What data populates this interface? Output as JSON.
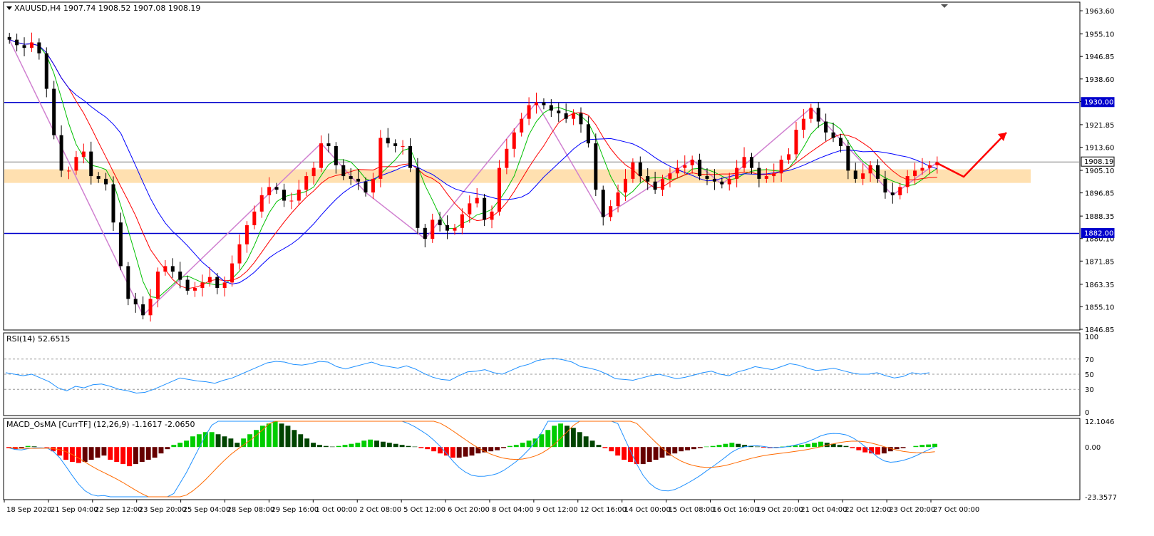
{
  "chart_data": {
    "type": "candlestick",
    "symbol_header": "XAUUSD,H4  1907.74 1908.52 1907.08 1908.19",
    "price_axis": {
      "ticks": [
        "1963.60",
        "1955.10",
        "1946.85",
        "1938.60",
        "1930.00",
        "1921.85",
        "1913.60",
        "1908.19",
        "1905.10",
        "1896.85",
        "1888.35",
        "1880.10",
        "1882.00",
        "1871.85",
        "1863.35",
        "1855.10",
        "1846.85"
      ],
      "tick_values": [
        1963.6,
        1955.1,
        1946.85,
        1938.6,
        1930.35,
        1921.85,
        1913.6,
        1905.1,
        1896.85,
        1888.35,
        1880.1,
        1871.85,
        1863.35,
        1855.1,
        1846.85
      ],
      "ylim": [
        1846.85,
        1966.5
      ],
      "levels": [
        {
          "label": "1930.00",
          "value": 1930.0,
          "color": "#0000cc"
        },
        {
          "label": "1882.00",
          "value": 1882.0,
          "color": "#0000cc"
        },
        {
          "label": "1908.19",
          "value": 1908.19,
          "color": "#808080"
        }
      ],
      "zone": {
        "low": 1900.5,
        "high": 1905.5,
        "color": "#ffe0b0"
      }
    },
    "time_axis": [
      "18 Sep 2020",
      "21 Sep 04:00",
      "22 Sep 12:00",
      "23 Sep 20:00",
      "25 Sep 04:00",
      "28 Sep 08:00",
      "29 Sep 16:00",
      "1 Oct 00:00",
      "2 Oct 08:00",
      "5 Oct 12:00",
      "6 Oct 20:00",
      "8 Oct 04:00",
      "9 Oct 12:00",
      "12 Oct 16:00",
      "14 Oct 00:00",
      "15 Oct 08:00",
      "16 Oct 16:00",
      "19 Oct 20:00",
      "21 Oct 04:00",
      "22 Oct 12:00",
      "23 Oct 20:00",
      "27 Oct 00:00"
    ],
    "close_path": [
      1953,
      1951,
      1950,
      1952,
      1948,
      1935,
      1918,
      1905,
      1905,
      1910,
      1912,
      1903,
      1902,
      1900,
      1886,
      1870,
      1858,
      1856,
      1852,
      1858,
      1868,
      1870,
      1868,
      1865,
      1861,
      1862,
      1864,
      1866,
      1862,
      1864,
      1871,
      1878,
      1885,
      1890,
      1896,
      1899,
      1898,
      1894,
      1894,
      1898,
      1903,
      1906,
      1915,
      1914,
      1907,
      1903,
      1902,
      1901,
      1897,
      1902,
      1917,
      1915,
      1914,
      1914,
      1906,
      1884,
      1880,
      1887,
      1885,
      1883,
      1884,
      1889,
      1893,
      1895,
      1887,
      1890,
      1906,
      1913,
      1919,
      1924,
      1929,
      1930,
      1929,
      1927,
      1926,
      1924,
      1926,
      1922,
      1915,
      1898,
      1888,
      1892,
      1897,
      1902,
      1908,
      1903,
      1901,
      1898,
      1902,
      1904,
      1906,
      1907,
      1909,
      1903,
      1902,
      1901,
      1900,
      1902,
      1906,
      1910,
      1906,
      1902,
      1903,
      1904,
      1909,
      1911,
      1920,
      1924,
      1928,
      1923,
      1919,
      1917,
      1914,
      1905,
      1902,
      1904,
      1907,
      1902,
      1897,
      1896,
      1899,
      1903,
      1905,
      1906,
      1907,
      1908
    ],
    "price_levels": {
      "zigzag_color": "#d080d0",
      "ma_fast": "#00c000",
      "ma_mid": "#ff0000",
      "ma_slow": "#0000ff"
    },
    "rsi": {
      "label": "RSI(14) 52.6515",
      "ticks": [
        "100",
        "70",
        "50",
        "30",
        "0"
      ],
      "tick_values": [
        100,
        70,
        50,
        30,
        0
      ],
      "levels": [
        70,
        50,
        30
      ],
      "values": [
        52,
        50,
        48,
        50,
        45,
        40,
        32,
        28,
        34,
        32,
        36,
        37,
        34,
        30,
        28,
        25,
        26,
        30,
        35,
        40,
        45,
        43,
        41,
        40,
        38,
        42,
        45,
        50,
        55,
        60,
        65,
        67,
        66,
        63,
        62,
        64,
        67,
        66,
        60,
        57,
        60,
        63,
        66,
        62,
        60,
        58,
        61,
        57,
        51,
        46,
        43,
        42,
        48,
        53,
        54,
        56,
        52,
        50,
        55,
        60,
        63,
        68,
        70,
        71,
        69,
        66,
        60,
        58,
        55,
        50,
        44,
        43,
        42,
        45,
        48,
        50,
        47,
        44,
        46,
        49,
        52,
        54,
        50,
        48,
        53,
        56,
        60,
        58,
        56,
        60,
        64,
        62,
        58,
        55,
        56,
        58,
        55,
        52,
        50,
        50,
        52,
        48,
        45,
        47,
        52,
        50,
        52
      ]
    },
    "macd": {
      "label": "MACD_OsMA [CurrTF] (12,26,9) -1.1617 -2.0650",
      "ticks": [
        "12.1046",
        "0.00",
        "-23.3577"
      ],
      "tick_values": [
        12.1046,
        0,
        -23.3577
      ],
      "histogram": [
        -0.5,
        -1,
        -0.5,
        0.5,
        0.3,
        0,
        -0.2,
        -2,
        -4,
        -6,
        -7,
        -7.5,
        -7,
        -6,
        -5,
        -4,
        -6,
        -7,
        -8,
        -9,
        -8,
        -7,
        -6,
        -5,
        -3,
        -1,
        1,
        2,
        3,
        5,
        6,
        7,
        7,
        6,
        5,
        4,
        2,
        4,
        6,
        8,
        10,
        11,
        12,
        11,
        10,
        8,
        6,
        4,
        2,
        1,
        0.5,
        0.2,
        0.5,
        1,
        1.5,
        2,
        3,
        3.5,
        3,
        2.5,
        2,
        1.5,
        1,
        0.5,
        0.2,
        -0.5,
        -1,
        -2,
        -3,
        -4,
        -5,
        -5,
        -4.5,
        -4,
        -3,
        -2.5,
        -2,
        -1.5,
        -0.5,
        0.5,
        1,
        2,
        3,
        4,
        6,
        8,
        10,
        11,
        10,
        9,
        7,
        5,
        3,
        1,
        -0.5,
        -2,
        -4,
        -6,
        -7,
        -8,
        -8,
        -7,
        -6,
        -5,
        -4,
        -3,
        -2,
        -1.5,
        -1,
        -0.5,
        0.2,
        0.5,
        1,
        1.5,
        2,
        1.5,
        1,
        0.5,
        0.2,
        -0.3,
        -0.5,
        -0.2,
        0.2,
        0.5,
        0.8,
        1,
        1.5,
        2,
        2.5,
        2,
        1.5,
        1,
        0.5,
        -0.5,
        -1.5,
        -2.5,
        -3,
        -3.5,
        -3,
        -2,
        -1,
        -0.5,
        0,
        0.5,
        1,
        1.2,
        1.5
      ],
      "macd_line_color": "#1e90ff",
      "signal_line_color": "#ff6a00"
    },
    "arrow": {
      "color": "#ff0000"
    }
  }
}
